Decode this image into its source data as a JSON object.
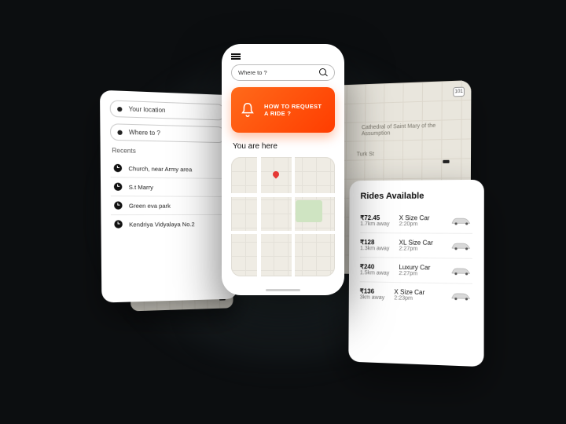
{
  "left": {
    "your_location": "Your location",
    "where_to": "Where to ?",
    "recents_header": "Recents",
    "recents": [
      "Church, near Army area",
      "S.t Marry",
      "Green eva park",
      "Kendriya Vidyalaya No.2"
    ]
  },
  "center": {
    "search_placeholder": "Where to ?",
    "promo_line1": "HOW TO REQUEST",
    "promo_line2": "A RIDE ?",
    "here_label": "You are here"
  },
  "bg_map": {
    "street": "Turk St",
    "poi": "Cathedral of Saint Mary of the Assumption",
    "shield": "101"
  },
  "rides": {
    "title": "Rides Available",
    "items": [
      {
        "price": "₹72.45",
        "away": "1.7km away",
        "name": "X Size Car",
        "eta": "2:20pm"
      },
      {
        "price": "₹128",
        "away": "1.3km away",
        "name": "XL Size Car",
        "eta": "2:27pm"
      },
      {
        "price": "₹240",
        "away": "1.5km away",
        "name": "Luxury Car",
        "eta": "2:27pm"
      },
      {
        "price": "₹136",
        "away": "3km away",
        "name": "X Size Car",
        "eta": "2:23pm"
      }
    ]
  }
}
